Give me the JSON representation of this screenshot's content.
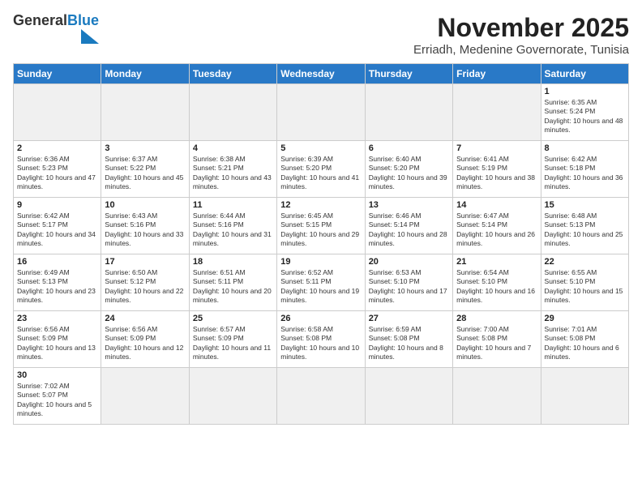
{
  "header": {
    "logo_general": "General",
    "logo_blue": "Blue",
    "month_year": "November 2025",
    "location": "Erriadh, Medenine Governorate, Tunisia"
  },
  "weekdays": [
    "Sunday",
    "Monday",
    "Tuesday",
    "Wednesday",
    "Thursday",
    "Friday",
    "Saturday"
  ],
  "weeks": [
    [
      {
        "day": "",
        "empty": true
      },
      {
        "day": "",
        "empty": true
      },
      {
        "day": "",
        "empty": true
      },
      {
        "day": "",
        "empty": true
      },
      {
        "day": "",
        "empty": true
      },
      {
        "day": "",
        "empty": true
      },
      {
        "day": "1",
        "sunrise": "6:35 AM",
        "sunset": "5:24 PM",
        "daylight": "10 hours and 48 minutes."
      }
    ],
    [
      {
        "day": "2",
        "sunrise": "6:36 AM",
        "sunset": "5:23 PM",
        "daylight": "10 hours and 47 minutes."
      },
      {
        "day": "3",
        "sunrise": "6:37 AM",
        "sunset": "5:22 PM",
        "daylight": "10 hours and 45 minutes."
      },
      {
        "day": "4",
        "sunrise": "6:38 AM",
        "sunset": "5:21 PM",
        "daylight": "10 hours and 43 minutes."
      },
      {
        "day": "5",
        "sunrise": "6:39 AM",
        "sunset": "5:20 PM",
        "daylight": "10 hours and 41 minutes."
      },
      {
        "day": "6",
        "sunrise": "6:40 AM",
        "sunset": "5:20 PM",
        "daylight": "10 hours and 39 minutes."
      },
      {
        "day": "7",
        "sunrise": "6:41 AM",
        "sunset": "5:19 PM",
        "daylight": "10 hours and 38 minutes."
      },
      {
        "day": "8",
        "sunrise": "6:42 AM",
        "sunset": "5:18 PM",
        "daylight": "10 hours and 36 minutes."
      }
    ],
    [
      {
        "day": "9",
        "sunrise": "6:42 AM",
        "sunset": "5:17 PM",
        "daylight": "10 hours and 34 minutes."
      },
      {
        "day": "10",
        "sunrise": "6:43 AM",
        "sunset": "5:16 PM",
        "daylight": "10 hours and 33 minutes."
      },
      {
        "day": "11",
        "sunrise": "6:44 AM",
        "sunset": "5:16 PM",
        "daylight": "10 hours and 31 minutes."
      },
      {
        "day": "12",
        "sunrise": "6:45 AM",
        "sunset": "5:15 PM",
        "daylight": "10 hours and 29 minutes."
      },
      {
        "day": "13",
        "sunrise": "6:46 AM",
        "sunset": "5:14 PM",
        "daylight": "10 hours and 28 minutes."
      },
      {
        "day": "14",
        "sunrise": "6:47 AM",
        "sunset": "5:14 PM",
        "daylight": "10 hours and 26 minutes."
      },
      {
        "day": "15",
        "sunrise": "6:48 AM",
        "sunset": "5:13 PM",
        "daylight": "10 hours and 25 minutes."
      }
    ],
    [
      {
        "day": "16",
        "sunrise": "6:49 AM",
        "sunset": "5:13 PM",
        "daylight": "10 hours and 23 minutes."
      },
      {
        "day": "17",
        "sunrise": "6:50 AM",
        "sunset": "5:12 PM",
        "daylight": "10 hours and 22 minutes."
      },
      {
        "day": "18",
        "sunrise": "6:51 AM",
        "sunset": "5:11 PM",
        "daylight": "10 hours and 20 minutes."
      },
      {
        "day": "19",
        "sunrise": "6:52 AM",
        "sunset": "5:11 PM",
        "daylight": "10 hours and 19 minutes."
      },
      {
        "day": "20",
        "sunrise": "6:53 AM",
        "sunset": "5:10 PM",
        "daylight": "10 hours and 17 minutes."
      },
      {
        "day": "21",
        "sunrise": "6:54 AM",
        "sunset": "5:10 PM",
        "daylight": "10 hours and 16 minutes."
      },
      {
        "day": "22",
        "sunrise": "6:55 AM",
        "sunset": "5:10 PM",
        "daylight": "10 hours and 15 minutes."
      }
    ],
    [
      {
        "day": "23",
        "sunrise": "6:56 AM",
        "sunset": "5:09 PM",
        "daylight": "10 hours and 13 minutes."
      },
      {
        "day": "24",
        "sunrise": "6:56 AM",
        "sunset": "5:09 PM",
        "daylight": "10 hours and 12 minutes."
      },
      {
        "day": "25",
        "sunrise": "6:57 AM",
        "sunset": "5:09 PM",
        "daylight": "10 hours and 11 minutes."
      },
      {
        "day": "26",
        "sunrise": "6:58 AM",
        "sunset": "5:08 PM",
        "daylight": "10 hours and 10 minutes."
      },
      {
        "day": "27",
        "sunrise": "6:59 AM",
        "sunset": "5:08 PM",
        "daylight": "10 hours and 8 minutes."
      },
      {
        "day": "28",
        "sunrise": "7:00 AM",
        "sunset": "5:08 PM",
        "daylight": "10 hours and 7 minutes."
      },
      {
        "day": "29",
        "sunrise": "7:01 AM",
        "sunset": "5:08 PM",
        "daylight": "10 hours and 6 minutes."
      }
    ],
    [
      {
        "day": "30",
        "sunrise": "7:02 AM",
        "sunset": "5:07 PM",
        "daylight": "10 hours and 5 minutes."
      },
      {
        "day": "",
        "empty": true
      },
      {
        "day": "",
        "empty": true
      },
      {
        "day": "",
        "empty": true
      },
      {
        "day": "",
        "empty": true
      },
      {
        "day": "",
        "empty": true
      },
      {
        "day": "",
        "empty": true
      }
    ]
  ]
}
